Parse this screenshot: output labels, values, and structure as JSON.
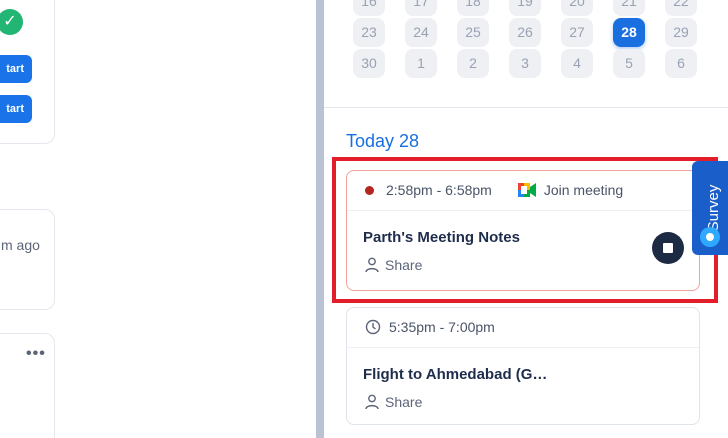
{
  "left": {
    "start_labels": [
      "tart",
      "tart"
    ],
    "time_ago": "m ago",
    "more_glyph": "•••"
  },
  "calendar": {
    "rows": [
      [
        "16",
        "17",
        "18",
        "19",
        "20",
        "21",
        "22"
      ],
      [
        "23",
        "24",
        "25",
        "26",
        "27",
        "28",
        "29"
      ],
      [
        "30",
        "1",
        "2",
        "3",
        "4",
        "5",
        "6"
      ]
    ],
    "selected_day": "28"
  },
  "today_heading": "Today 28",
  "events": [
    {
      "time": "2:58pm - 6:58pm",
      "join_label": "Join meeting",
      "title": "Parth's Meeting Notes",
      "share_label": "Share",
      "recording": true
    },
    {
      "time": "5:35pm - 7:00pm",
      "title": "Flight to Ahmedabad (G…",
      "share_label": "Share"
    }
  ],
  "survey": {
    "label": "Survey"
  },
  "colors": {
    "accent": "#1a6fe0",
    "highlight_box": "#e41d2a",
    "recording_dot": "#b3261e",
    "check": "#22b573"
  },
  "icons": [
    "check-icon",
    "more-icon",
    "google-meet-icon",
    "person-icon",
    "clock-icon",
    "stop-icon",
    "survey-icon"
  ]
}
